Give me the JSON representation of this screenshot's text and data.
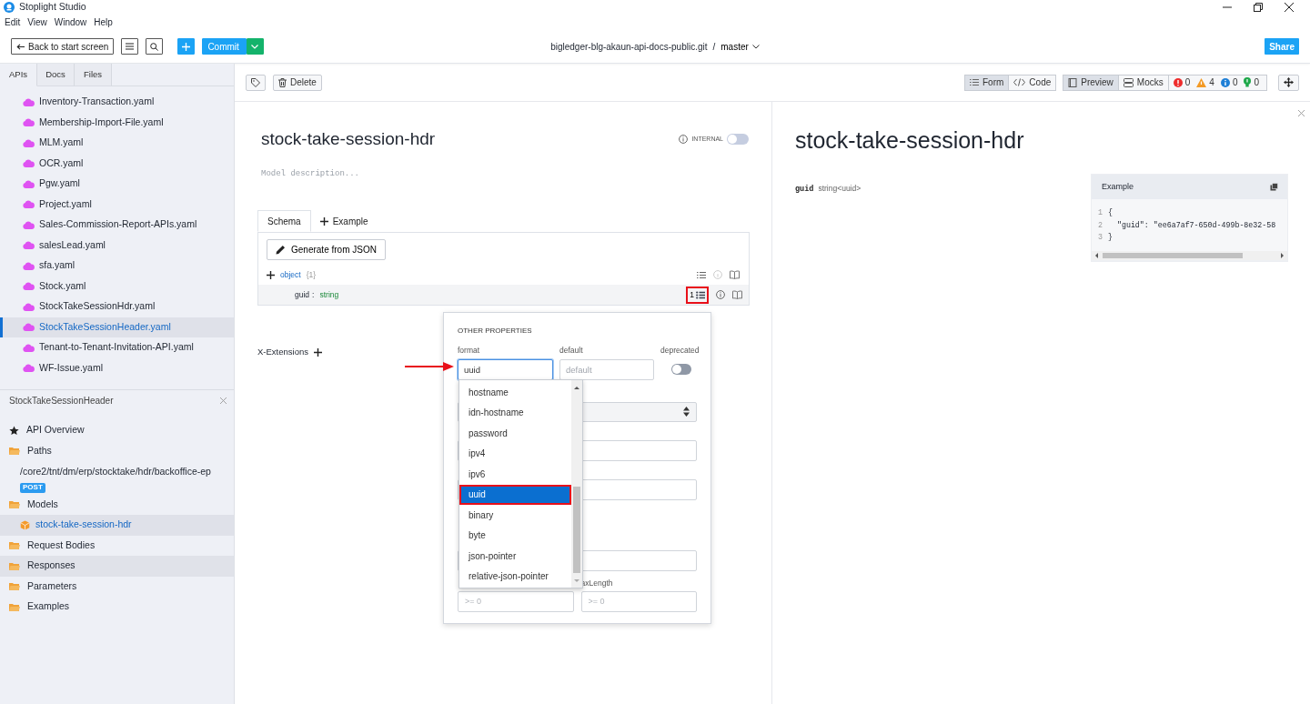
{
  "window": {
    "title": "Stoplight Studio"
  },
  "menu": [
    "Edit",
    "View",
    "Window",
    "Help"
  ],
  "toolbar": {
    "back_label": "Back to start screen",
    "commit_label": "Commit",
    "repo": "bigledger-blg-akaun-api-docs-public.git",
    "separator": "/",
    "branch": "master",
    "share_label": "Share"
  },
  "sidebar": {
    "tabs": [
      {
        "label": "APIs",
        "selected": true
      },
      {
        "label": "Docs",
        "selected": false
      },
      {
        "label": "Files",
        "selected": false
      }
    ],
    "files": [
      {
        "name": "Inventory-Transaction.yaml",
        "selected": false
      },
      {
        "name": "Membership-Import-File.yaml",
        "selected": false
      },
      {
        "name": "MLM.yaml",
        "selected": false
      },
      {
        "name": "OCR.yaml",
        "selected": false
      },
      {
        "name": "Pgw.yaml",
        "selected": false
      },
      {
        "name": "Project.yaml",
        "selected": false
      },
      {
        "name": "Sales-Commission-Report-APIs.yaml",
        "selected": false
      },
      {
        "name": "salesLead.yaml",
        "selected": false
      },
      {
        "name": "sfa.yaml",
        "selected": false
      },
      {
        "name": "Stock.yaml",
        "selected": false
      },
      {
        "name": "StockTakeSessionHdr.yaml",
        "selected": false
      },
      {
        "name": "StockTakeSessionHeader.yaml",
        "selected": true
      },
      {
        "name": "Tenant-to-Tenant-Invitation-API.yaml",
        "selected": false
      },
      {
        "name": "WF-Issue.yaml",
        "selected": false
      }
    ],
    "outline": {
      "title": "StockTakeSessionHeader",
      "items": [
        {
          "kind": "overview",
          "label": "API Overview",
          "selected": false,
          "hovered": false
        },
        {
          "kind": "folder",
          "label": "Paths",
          "selected": false,
          "hovered": false,
          "children": [
            {
              "kind": "path",
              "label": "/core2/tnt/dm/erp/stocktake/hdr/backoffice-ep",
              "method": "POST",
              "selected": false
            }
          ]
        },
        {
          "kind": "folder",
          "label": "Models",
          "selected": false,
          "hovered": false,
          "children": [
            {
              "kind": "model",
              "label": "stock-take-session-hdr",
              "selected": true
            }
          ]
        },
        {
          "kind": "folder",
          "label": "Request Bodies",
          "selected": false,
          "hovered": false
        },
        {
          "kind": "folder",
          "label": "Responses",
          "selected": false,
          "hovered": true
        },
        {
          "kind": "folder",
          "label": "Parameters",
          "selected": false,
          "hovered": false
        },
        {
          "kind": "folder",
          "label": "Examples",
          "selected": false,
          "hovered": false
        }
      ]
    }
  },
  "editor": {
    "toolbar": {
      "delete_label": "Delete",
      "modes": [
        {
          "kind": "form",
          "label": "Form",
          "selected": true
        },
        {
          "kind": "code",
          "label": "Code",
          "selected": false
        }
      ],
      "panes": [
        {
          "kind": "preview",
          "label": "Preview",
          "selected": true
        },
        {
          "kind": "mocks",
          "label": "Mocks",
          "selected": false
        }
      ],
      "counts": [
        {
          "kind": "error",
          "count": "0"
        },
        {
          "kind": "warning",
          "count": "4"
        },
        {
          "kind": "info",
          "count": "0"
        },
        {
          "kind": "hint",
          "count": "0"
        }
      ]
    },
    "title": "stock-take-session-hdr",
    "internal": {
      "label": "INTERNAL",
      "on": false
    },
    "description_placeholder": "Model description...",
    "tabs": [
      {
        "kind": "tab",
        "label": "Schema",
        "selected": true
      },
      {
        "kind": "add",
        "label": "Example",
        "selected": false
      }
    ],
    "generate_label": "Generate from JSON",
    "schema_rows": [
      {
        "kind": "root",
        "name": "object",
        "detail": "{1}"
      },
      {
        "kind": "property",
        "name": "guid",
        "separator": ":",
        "type": "string",
        "rule_count": "1",
        "highlighted": true
      }
    ],
    "extensions_label": "X-Extensions",
    "popover": {
      "title": "OTHER PROPERTIES",
      "format": {
        "label": "format",
        "value": "uuid",
        "focused": true
      },
      "default": {
        "label": "default",
        "placeholder": "default"
      },
      "deprecated": {
        "label": "deprecated",
        "on": false
      },
      "hidden_controls": [
        {
          "kind": "select"
        },
        {
          "kind": "input"
        },
        {
          "kind": "input"
        },
        {
          "kind": "input"
        }
      ],
      "bottom_row": {
        "label": "axLength",
        "fields": [
          {
            "placeholder": ">= 0"
          },
          {
            "placeholder": ">= 0"
          }
        ]
      },
      "options": [
        {
          "label": "hostname",
          "selected": false,
          "highlighted": false
        },
        {
          "label": "idn-hostname",
          "selected": false,
          "highlighted": false
        },
        {
          "label": "password",
          "selected": false,
          "highlighted": false
        },
        {
          "label": "ipv4",
          "selected": false,
          "highlighted": false
        },
        {
          "label": "ipv6",
          "selected": false,
          "highlighted": false
        },
        {
          "label": "uuid",
          "selected": true,
          "highlighted": true
        },
        {
          "label": "binary",
          "selected": false,
          "highlighted": false
        },
        {
          "label": "byte",
          "selected": false,
          "highlighted": false
        },
        {
          "label": "json-pointer",
          "selected": false,
          "highlighted": false
        },
        {
          "label": "relative-json-pointer",
          "selected": false,
          "highlighted": false
        }
      ],
      "annotation_arrow": true
    }
  },
  "preview": {
    "title": "stock-take-session-hdr",
    "properties": [
      {
        "name": "guid",
        "type": "string<uuid>"
      }
    ],
    "example": {
      "title": "Example",
      "lines": [
        {
          "number": "1",
          "code": "{"
        },
        {
          "number": "2",
          "code": "  \"guid\": \"ee6a7af7-650d-499b-8e32-58"
        },
        {
          "number": "3",
          "code": "}"
        }
      ]
    }
  }
}
